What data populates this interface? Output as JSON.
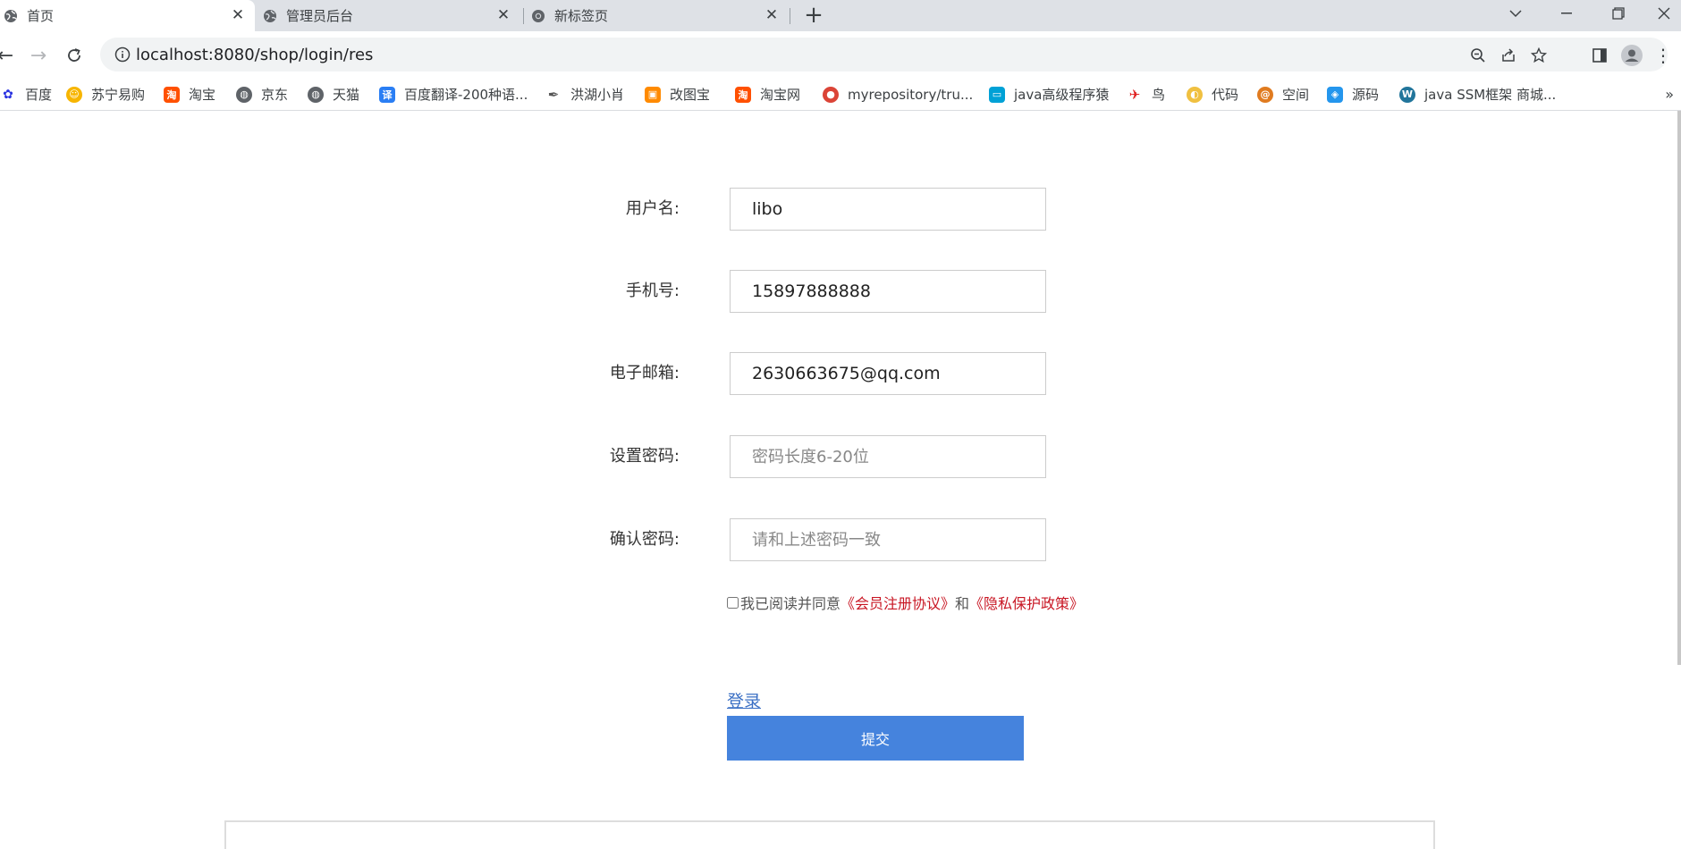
{
  "tabs": [
    {
      "title": "首页",
      "icon": "globe-icon"
    },
    {
      "title": "管理员后台",
      "icon": "globe-icon"
    },
    {
      "title": "新标签页",
      "icon": "chrome-icon"
    }
  ],
  "address_bar": {
    "url": "localhost:8080/shop/login/res"
  },
  "bookmarks": [
    {
      "label": "百度",
      "icon": "baidu-icon",
      "color": "#2932e1"
    },
    {
      "label": "苏宁易购",
      "icon": "suning-icon",
      "color": "#f7b500"
    },
    {
      "label": "淘宝",
      "icon": "taobao-icon",
      "color": "#ff5000"
    },
    {
      "label": "京东",
      "icon": "globe-icon",
      "color": "#5f6368"
    },
    {
      "label": "天猫",
      "icon": "globe-icon",
      "color": "#5f6368"
    },
    {
      "label": "百度翻译-200种语...",
      "icon": "translate-icon",
      "color": "#2a7ef4"
    },
    {
      "label": "洪湖小肖",
      "icon": "feather-icon",
      "color": "#555555"
    },
    {
      "label": "改图宝",
      "icon": "gaitubao-icon",
      "color": "#ff8a00"
    },
    {
      "label": "淘宝网",
      "icon": "taobao-icon",
      "color": "#ff5000"
    },
    {
      "label": "myrepository/tru...",
      "icon": "chrome-icon",
      "color": "#db4437"
    },
    {
      "label": "java高级程序猿",
      "icon": "bilibili-icon",
      "color": "#00a1d6"
    },
    {
      "label": "鸟",
      "icon": "bird-icon",
      "color": "#e02020"
    },
    {
      "label": "代码",
      "icon": "code-icon",
      "color": "#f0c040"
    },
    {
      "label": "空间",
      "icon": "space-icon",
      "color": "#e07b20"
    },
    {
      "label": "源码",
      "icon": "docker-icon",
      "color": "#2496ed"
    },
    {
      "label": "java SSM框架 商城...",
      "icon": "wordpress-icon",
      "color": "#21759b"
    }
  ],
  "form": {
    "username_label": "用户名:",
    "username_value": "libo",
    "phone_label": "手机号:",
    "phone_value": "15897888888",
    "email_label": "电子邮箱:",
    "email_value": "2630663675@qq.com",
    "password_label": "设置密码:",
    "password_placeholder": "密码长度6-20位",
    "confirm_label": "确认密码:",
    "confirm_placeholder": "请和上述密码一致",
    "agree_text": "我已阅读并同意",
    "agreement_link": "《会员注册协议》",
    "and_text": "和",
    "privacy_link": "《隐私保护政策》",
    "login_link": "登录",
    "submit_label": "提交"
  },
  "colors": {
    "primary_button": "#4583dd",
    "link_red": "#c81623",
    "link_blue": "#3a6fc4"
  }
}
